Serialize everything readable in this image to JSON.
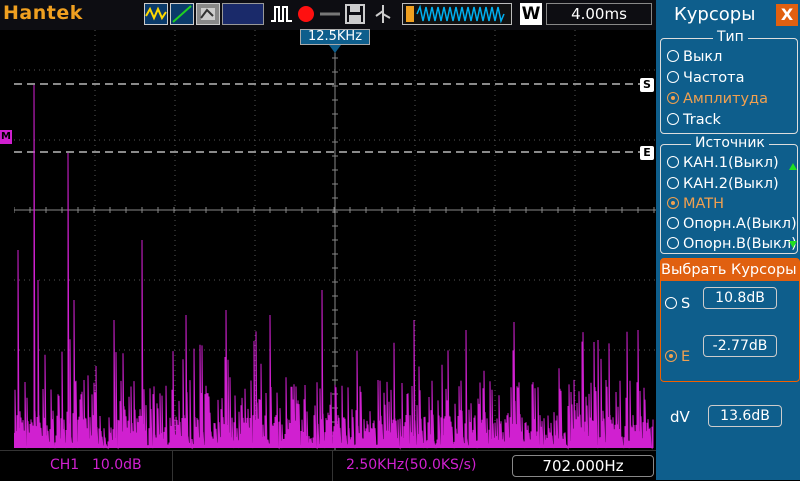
{
  "topbar": {
    "brand": "Hantek",
    "timebase": "4.00ms",
    "trigger_letter": "W"
  },
  "screen": {
    "marker_freq": "12.5KHz",
    "cursor_s_label": "S",
    "cursor_e_label": "E",
    "channel_marker": "M"
  },
  "bottombar": {
    "ch1": "CH1",
    "ch1_scale": "10.0dB",
    "span": "2.50KHz(50.0KS/s)",
    "freq": "702.000Hz"
  },
  "sidebar": {
    "title": "Курсоры",
    "close": "X",
    "type_group": {
      "label": "Тип",
      "options": [
        "Выкл",
        "Частота",
        "Амплитуда",
        "Track"
      ],
      "selected": 2
    },
    "source_group": {
      "label": "Источник",
      "options": [
        "КАН.1(Выкл)",
        "КАН.2(Выкл)",
        "MATH",
        "Опорн.А(Выкл)",
        "Опорн.В(Выкл)"
      ],
      "selected": 2
    },
    "select_cursor": {
      "title": "Выбрать  Курсоры",
      "s_label": "S",
      "s_value": "10.8dB",
      "e_label": "E",
      "e_value": "-2.77dB"
    },
    "dv_label": "dV",
    "dv_value": "13.6dB"
  },
  "colors": {
    "trace": "#d020d0",
    "panel": "#0e5e8c",
    "accent": "#e06010",
    "brand": "#f0a020"
  }
}
